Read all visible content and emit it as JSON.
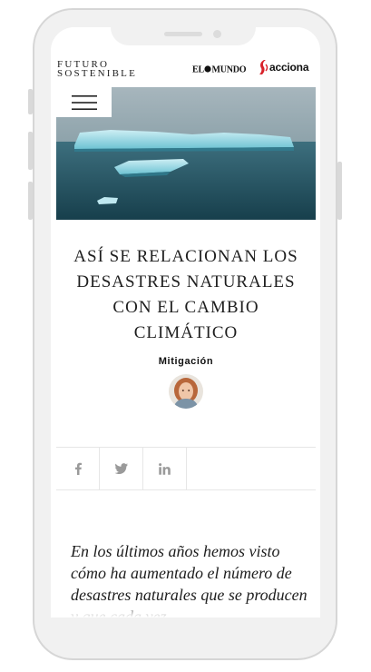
{
  "header": {
    "brand_line1": "FUTURO",
    "brand_line2": "SOSTENIBLE",
    "partner_logo_1": "EL MUNDO",
    "partner_logo_2": "acciona"
  },
  "hero": {
    "icons": [
      "hamburger-menu-icon"
    ]
  },
  "article": {
    "title": "ASÍ SE RELACIONAN LOS DESASTRES NATURALES CON EL CAMBIO CLIMÁTICO",
    "category": "Mitigación",
    "lead": "En los últimos años hemos visto cómo ha aumentado el número de desastres naturales que se producen y que cada vez"
  },
  "share": {
    "items": [
      {
        "icon": "facebook-icon"
      },
      {
        "icon": "twitter-icon"
      },
      {
        "icon": "linkedin-icon"
      }
    ]
  },
  "colors": {
    "frame": "#f1f1f1",
    "text": "#1e1e1e",
    "acciona_red": "#d8222a",
    "icon_gray": "#9a9a9a"
  }
}
